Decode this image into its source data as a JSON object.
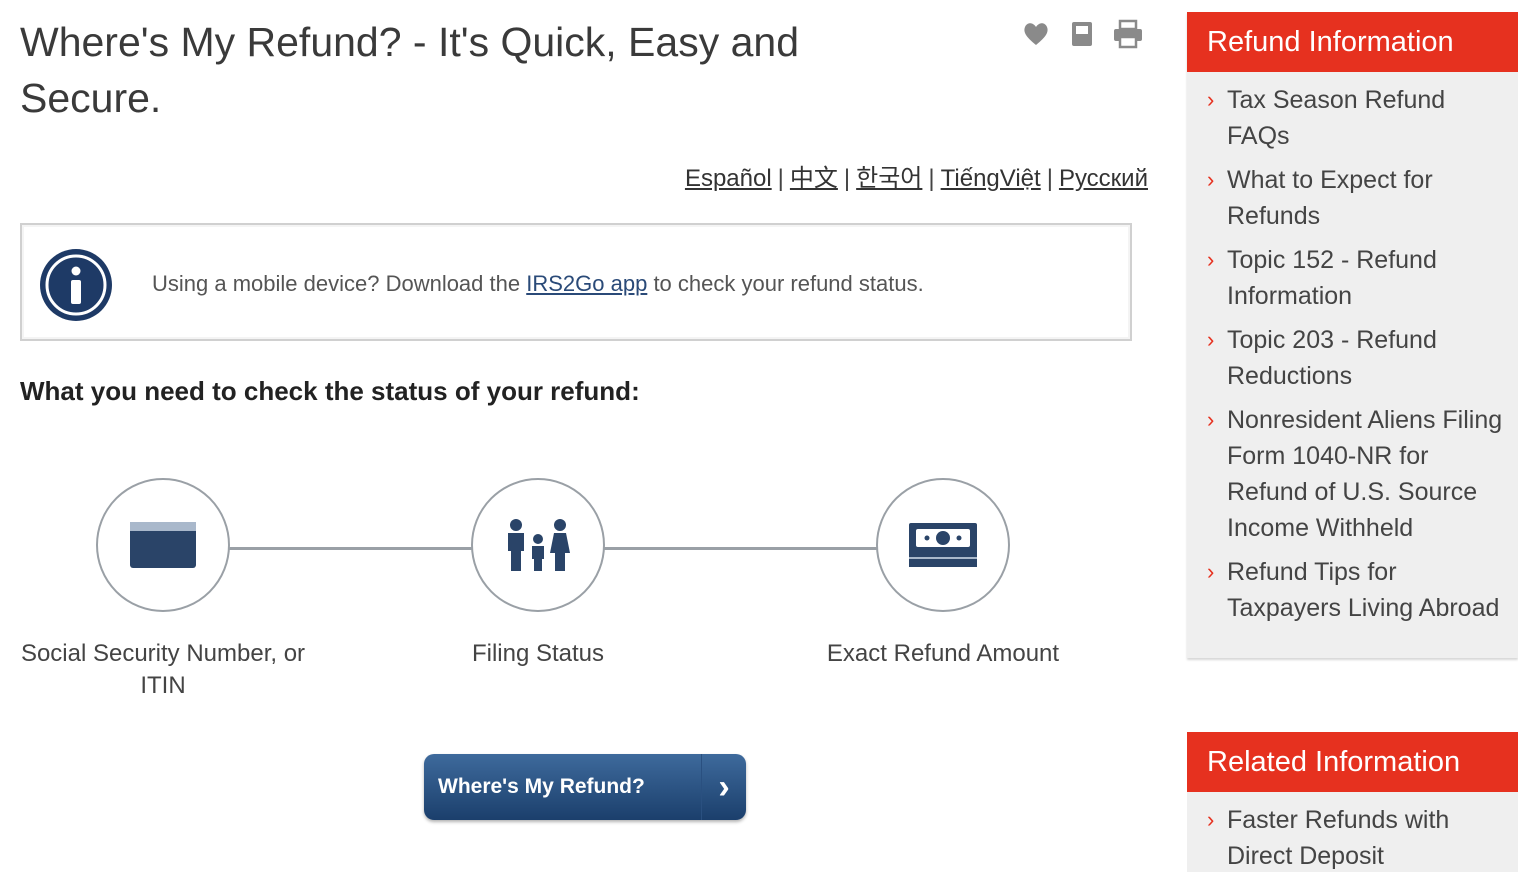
{
  "header": {
    "title": "Where's My Refund? - It's Quick, Easy and Secure."
  },
  "tools": {
    "icons": [
      "heart-icon",
      "bookmark-icon",
      "print-icon"
    ]
  },
  "languages": [
    "Español",
    "中文",
    "한국어",
    "TiếngViệt",
    "Pусский"
  ],
  "mobile_notice": {
    "prefix": "Using a mobile device? Download the",
    "link": "IRS2Go app",
    "suffix": "to check your refund status."
  },
  "requirements": {
    "heading": "What you need to check the status of your refund:",
    "steps": [
      {
        "label": "Social Security Number, or ITIN",
        "icon": "id-card-icon"
      },
      {
        "label": "Filing Status",
        "icon": "family-icon"
      },
      {
        "label": "Exact Refund Amount",
        "icon": "money-icon"
      }
    ]
  },
  "action": {
    "button_label": "Where's My Refund?"
  },
  "sidebar": {
    "refund_info": {
      "title": "Refund Information",
      "items": [
        "Tax Season Refund FAQs",
        "What to Expect for Refunds",
        "Topic 152 - Refund Information",
        "Topic 203 - Refund Reductions",
        "Nonresident Aliens Filing Form 1040-NR for Refund of U.S. Source Income Withheld",
        "Refund Tips for Taxpayers Living Abroad"
      ]
    },
    "related_info": {
      "title": "Related Information",
      "items": [
        "Faster Refunds with Direct Deposit"
      ]
    }
  },
  "colors": {
    "accent_red": "#e6311f",
    "button_blue": "#1b3f6c",
    "icon_navy": "#2a4468"
  }
}
